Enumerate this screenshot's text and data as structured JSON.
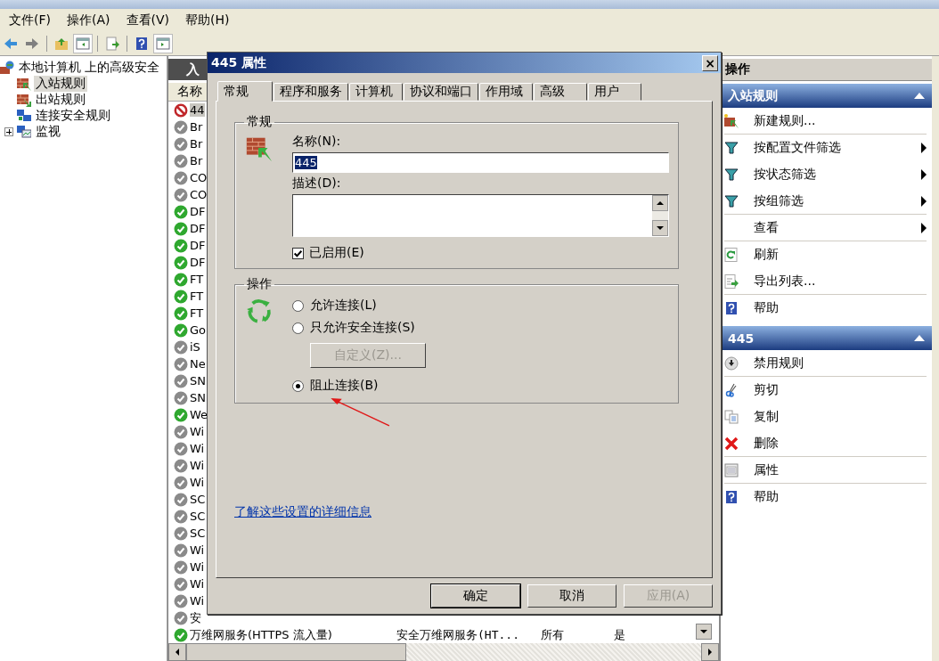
{
  "menu": [
    "文件(F)",
    "操作(A)",
    "查看(V)",
    "帮助(H)"
  ],
  "tree": {
    "label": "本地计算机 上的高级安全",
    "children": [
      {
        "label": "入站规则",
        "selected": true,
        "kind": "inbound"
      },
      {
        "label": "出站规则",
        "selected": false,
        "kind": "outbound"
      },
      {
        "label": "连接安全规则",
        "selected": false,
        "kind": "connection"
      },
      {
        "label": "监视",
        "selected": false,
        "kind": "monitor",
        "expanded": false
      }
    ]
  },
  "list": {
    "title": "入",
    "columns": [
      "名称"
    ],
    "rows": [
      {
        "cells": [
          "44"
        ],
        "kind": "block",
        "selected": true
      },
      {
        "cells": [
          "Br"
        ],
        "kind": "allow",
        "enabled": false,
        "selected": false
      },
      {
        "cells": [
          "Br"
        ],
        "kind": "allow",
        "enabled": false,
        "selected": false
      },
      {
        "cells": [
          "Br"
        ],
        "kind": "allow",
        "enabled": false,
        "selected": false
      },
      {
        "cells": [
          "CO"
        ],
        "kind": "allow",
        "enabled": false,
        "selected": false
      },
      {
        "cells": [
          "CO"
        ],
        "kind": "allow",
        "enabled": false,
        "selected": false
      },
      {
        "cells": [
          "DF"
        ],
        "kind": "allow",
        "enabled": true,
        "selected": false
      },
      {
        "cells": [
          "DF"
        ],
        "kind": "allow",
        "enabled": true,
        "selected": false
      },
      {
        "cells": [
          "DF"
        ],
        "kind": "allow",
        "enabled": true,
        "selected": false
      },
      {
        "cells": [
          "DF"
        ],
        "kind": "allow",
        "enabled": true,
        "selected": false
      },
      {
        "cells": [
          "FT"
        ],
        "kind": "allow",
        "enabled": true,
        "selected": false
      },
      {
        "cells": [
          "FT"
        ],
        "kind": "allow",
        "enabled": true,
        "selected": false
      },
      {
        "cells": [
          "FT"
        ],
        "kind": "allow",
        "enabled": true,
        "selected": false
      },
      {
        "cells": [
          "Go"
        ],
        "kind": "allow",
        "enabled": true,
        "selected": false
      },
      {
        "cells": [
          "iS"
        ],
        "kind": "allow",
        "enabled": false,
        "selected": false
      },
      {
        "cells": [
          "Ne"
        ],
        "kind": "allow",
        "enabled": false,
        "selected": false
      },
      {
        "cells": [
          "SN"
        ],
        "kind": "allow",
        "enabled": false,
        "selected": false
      },
      {
        "cells": [
          "SN"
        ],
        "kind": "allow",
        "enabled": false,
        "selected": false
      },
      {
        "cells": [
          "We"
        ],
        "kind": "allow",
        "enabled": true,
        "selected": false
      },
      {
        "cells": [
          "Wi"
        ],
        "kind": "allow",
        "enabled": false,
        "selected": false
      },
      {
        "cells": [
          "Wi"
        ],
        "kind": "allow",
        "enabled": false,
        "selected": false
      },
      {
        "cells": [
          "Wi"
        ],
        "kind": "allow",
        "enabled": false,
        "selected": false
      },
      {
        "cells": [
          "Wi"
        ],
        "kind": "allow",
        "enabled": false,
        "selected": false
      },
      {
        "cells": [
          "SC"
        ],
        "kind": "allow",
        "enabled": false,
        "selected": false
      },
      {
        "cells": [
          "SC"
        ],
        "kind": "allow",
        "enabled": false,
        "selected": false
      },
      {
        "cells": [
          "SC"
        ],
        "kind": "allow",
        "enabled": false,
        "selected": false
      },
      {
        "cells": [
          "Wi"
        ],
        "kind": "allow",
        "enabled": false,
        "selected": false
      },
      {
        "cells": [
          "Wi"
        ],
        "kind": "allow",
        "enabled": false,
        "selected": false
      },
      {
        "cells": [
          "Wi"
        ],
        "kind": "allow",
        "enabled": false,
        "selected": false
      },
      {
        "cells": [
          "Wi"
        ],
        "kind": "allow",
        "enabled": false,
        "selected": false
      },
      {
        "cells": [
          "安"
        ],
        "kind": "allow",
        "enabled": false,
        "selected": false
      },
      {
        "cells": [
          "万维网服务(HTTPS 流入量)",
          "安全万维网服务(HT...",
          "所有",
          "是"
        ],
        "kind": "allow",
        "enabled": true,
        "selected": false
      }
    ]
  },
  "actions": {
    "title": "操作",
    "sections": [
      {
        "title": "入站规则",
        "items": [
          {
            "label": "新建规则...",
            "kind": "new",
            "submenu": false,
            "divider": true
          },
          {
            "label": "按配置文件筛选",
            "kind": "filter",
            "submenu": true,
            "divider": false
          },
          {
            "label": "按状态筛选",
            "kind": "filter",
            "submenu": true,
            "divider": false
          },
          {
            "label": "按组筛选",
            "kind": "filter",
            "submenu": true,
            "divider": true
          },
          {
            "label": "查看",
            "kind": "none",
            "submenu": true,
            "divider": true
          },
          {
            "label": "刷新",
            "kind": "refresh",
            "submenu": false,
            "divider": false
          },
          {
            "label": "导出列表...",
            "kind": "export",
            "submenu": false,
            "divider": true
          },
          {
            "label": "帮助",
            "kind": "help",
            "submenu": false,
            "divider": false
          }
        ]
      },
      {
        "title": "445",
        "items": [
          {
            "label": "禁用规则",
            "kind": "disable",
            "submenu": false,
            "divider": true
          },
          {
            "label": "剪切",
            "kind": "cut",
            "submenu": false,
            "divider": false
          },
          {
            "label": "复制",
            "kind": "copy",
            "submenu": false,
            "divider": false
          },
          {
            "label": "删除",
            "kind": "delete",
            "submenu": false,
            "divider": true
          },
          {
            "label": "属性",
            "kind": "properties",
            "submenu": false,
            "divider": true
          },
          {
            "label": "帮助",
            "kind": "help",
            "submenu": false,
            "divider": false
          }
        ]
      }
    ]
  },
  "dialog": {
    "title": "445 属性",
    "close": "×",
    "tabs": [
      {
        "label": "常规",
        "selected": true
      },
      {
        "label": "程序和服务",
        "selected": false
      },
      {
        "label": "计算机",
        "selected": false
      },
      {
        "label": "协议和端口",
        "selected": false
      },
      {
        "label": "作用域",
        "selected": false
      },
      {
        "label": "高级",
        "selected": false
      },
      {
        "label": "用户",
        "selected": false
      }
    ],
    "general": {
      "title": "常规",
      "name_label": "名称(N):",
      "name_value": "445",
      "description_label": "描述(D):",
      "enabled": {
        "label": "已启用(E)",
        "checked": true
      }
    },
    "action": {
      "title": "操作",
      "options": [
        {
          "label": "允许连接(L)",
          "selected": false
        },
        {
          "label": "只允许安全连接(S)",
          "selected": false
        },
        {
          "label": "阻止连接(B)",
          "selected": true
        }
      ],
      "customize": {
        "label": "自定义(Z)...",
        "disabled": true
      }
    },
    "link": "了解这些设置的详细信息",
    "buttons": [
      {
        "label": "确定",
        "disabled": false,
        "default": true
      },
      {
        "label": "取消",
        "disabled": false,
        "default": false
      },
      {
        "label": "应用(A)",
        "disabled": true,
        "default": false
      }
    ]
  }
}
